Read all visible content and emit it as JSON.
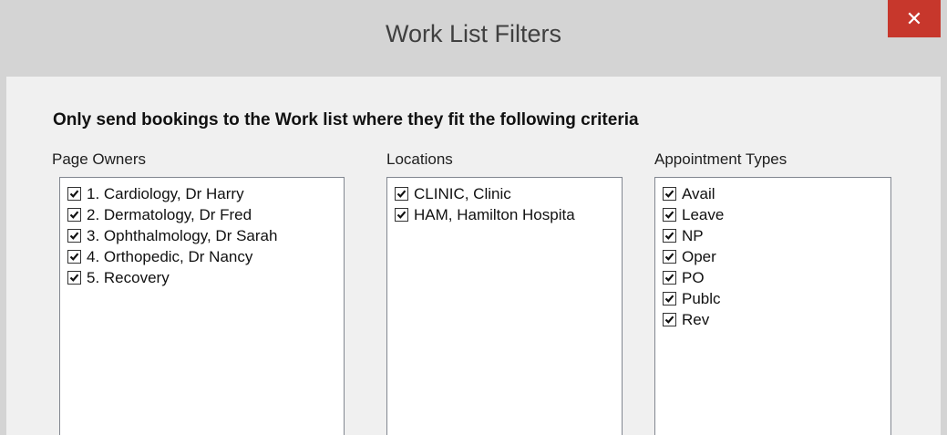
{
  "window": {
    "title": "Work List Filters",
    "close_glyph": "✕"
  },
  "heading": "Only send bookings to the Work list where they fit the following criteria",
  "page_owners": {
    "label": "Page Owners",
    "items": [
      {
        "label": "1. Cardiology, Dr Harry",
        "checked": true
      },
      {
        "label": "2. Dermatology, Dr Fred",
        "checked": true
      },
      {
        "label": "3. Ophthalmology, Dr Sarah",
        "checked": true
      },
      {
        "label": "4. Orthopedic, Dr Nancy",
        "checked": true
      },
      {
        "label": "5. Recovery",
        "checked": true
      }
    ]
  },
  "locations": {
    "label": "Locations",
    "items": [
      {
        "label": "CLINIC, Clinic",
        "checked": true
      },
      {
        "label": "HAM, Hamilton Hospita",
        "checked": true
      }
    ]
  },
  "appointment_types": {
    "label": "Appointment Types",
    "items": [
      {
        "label": "Avail",
        "checked": true
      },
      {
        "label": "Leave",
        "checked": true
      },
      {
        "label": "NP",
        "checked": true
      },
      {
        "label": "Oper",
        "checked": true
      },
      {
        "label": "PO",
        "checked": true
      },
      {
        "label": "Publc",
        "checked": true
      },
      {
        "label": "Rev",
        "checked": true
      }
    ]
  },
  "colors": {
    "close_button": "#c7372c",
    "title_bar": "#d4d4d4",
    "dialog_background": "#f0f0f0"
  }
}
